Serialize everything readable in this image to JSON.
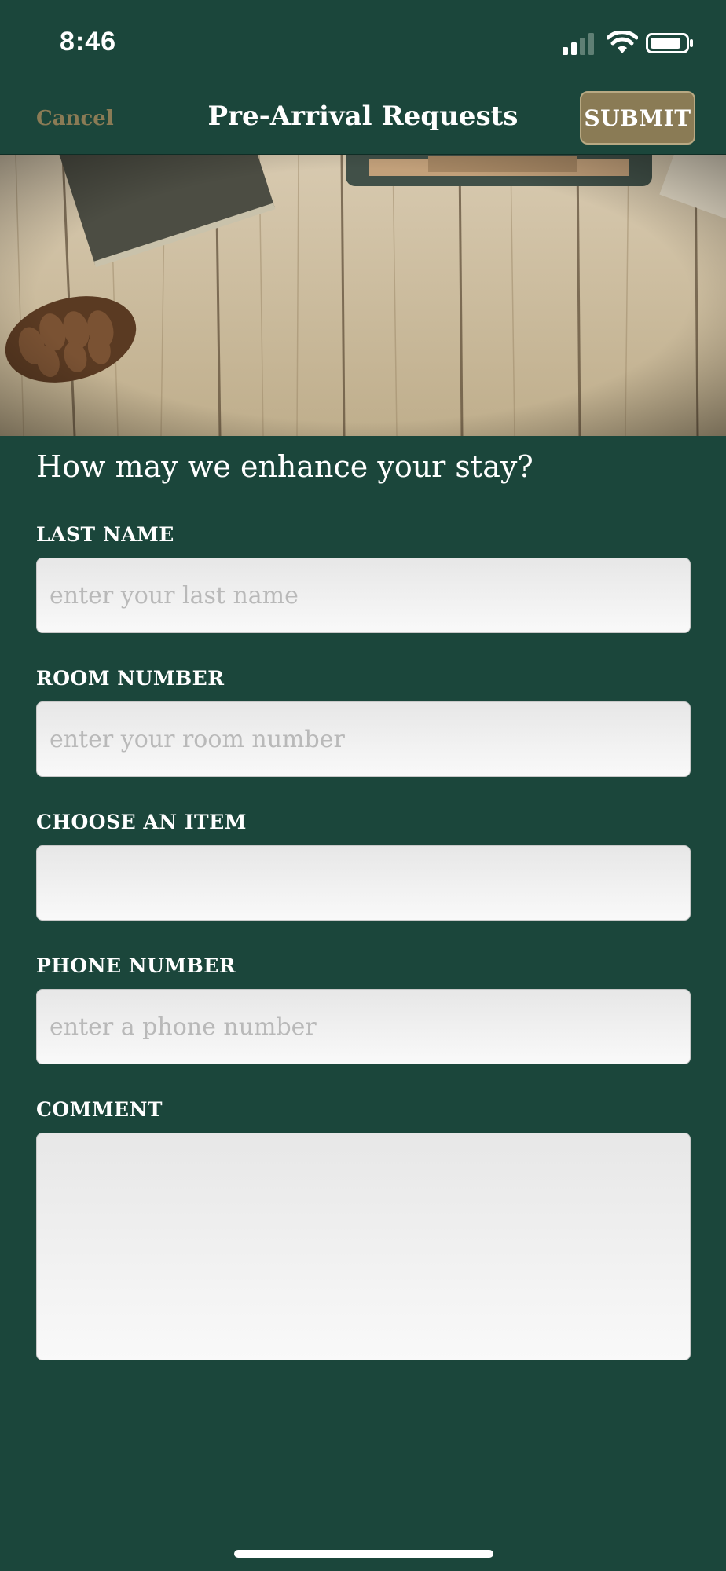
{
  "status_bar": {
    "time": "8:46",
    "icons": [
      "cellular-signal-icon",
      "wifi-icon",
      "battery-icon"
    ]
  },
  "nav": {
    "cancel_label": "Cancel",
    "title": "Pre-Arrival Requests",
    "submit_label": "SUBMIT"
  },
  "form": {
    "heading": "How may we enhance your stay?",
    "last_name": {
      "label": "LAST NAME",
      "placeholder": "enter your last name",
      "value": ""
    },
    "room_number": {
      "label": "ROOM NUMBER",
      "placeholder": "enter your room number",
      "value": ""
    },
    "item": {
      "label": "CHOOSE AN ITEM",
      "value": ""
    },
    "phone_number": {
      "label": "PHONE NUMBER",
      "placeholder": "enter a phone number",
      "value": ""
    },
    "comment": {
      "label": "COMMENT",
      "value": ""
    }
  },
  "colors": {
    "background": "#1b463b",
    "accent": "#8a7b55",
    "text": "#ffffff",
    "input_bg": "#f2f2f2"
  }
}
